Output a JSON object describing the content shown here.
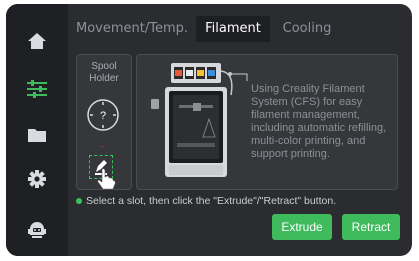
{
  "tabs": [
    {
      "label": "Movement/Temp.",
      "active": false
    },
    {
      "label": "Filament",
      "active": true
    },
    {
      "label": "Cooling",
      "active": false
    }
  ],
  "sidebar": {
    "items": [
      {
        "icon": "home-icon",
        "active": false
      },
      {
        "icon": "sliders-icon",
        "active": true
      },
      {
        "icon": "folder-icon",
        "active": false
      },
      {
        "icon": "gear-icon",
        "active": false
      },
      {
        "icon": "robot-icon",
        "active": false
      }
    ]
  },
  "spool_holder": {
    "title": "Spool Holder",
    "slot_label": "?",
    "slot_marker": "--"
  },
  "cfs_info": {
    "text": "Using Creality Filament System (CFS) for easy filament management, including automatic refilling, multi-color printing, and support printing."
  },
  "hint": "Select a slot, then click the \"Extrude\"/\"Retract\" button.",
  "buttons": {
    "extrude": "Extrude",
    "retract": "Retract"
  },
  "colors": {
    "accent": "#3fba5d",
    "background": "#2a2c30",
    "sidebar": "#1f2023"
  }
}
